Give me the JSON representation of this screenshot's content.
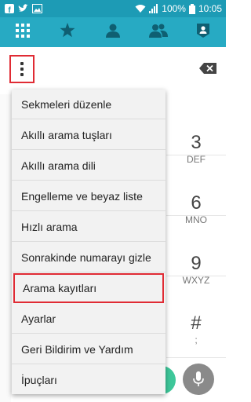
{
  "status_bar": {
    "left_icons": [
      "facebook-icon",
      "twitter-icon",
      "image-icon"
    ],
    "battery": "100%",
    "time": "10:05"
  },
  "tabs": [
    {
      "name": "dialpad-tab",
      "icon": "grid-icon",
      "active": true
    },
    {
      "name": "favorites-tab",
      "icon": "star-icon",
      "active": false
    },
    {
      "name": "contacts-tab",
      "icon": "person-icon",
      "active": false
    },
    {
      "name": "groups-tab",
      "icon": "group-icon",
      "active": false
    },
    {
      "name": "profile-tab",
      "icon": "profile-badge-icon",
      "active": false
    }
  ],
  "keypad": {
    "keys": [
      {
        "num": "3",
        "sub": "DEF"
      },
      {
        "num": "6",
        "sub": "MNO"
      },
      {
        "num": "9",
        "sub": "WXYZ"
      },
      {
        "num": "#",
        "sub": ";"
      }
    ]
  },
  "menu": {
    "items": [
      "Sekmeleri düzenle",
      "Akıllı arama tuşları",
      "Akıllı arama dili",
      "Engelleme ve beyaz liste",
      "Hızlı arama",
      "Sonrakinde numarayı gizle",
      "Arama kayıtları",
      "Ayarlar",
      "Geri Bildirim ve Yardım",
      "İpuçları"
    ],
    "highlighted_index": 6
  },
  "colors": {
    "status_bar": "#1d9bb5",
    "tab_bar": "#27aac3",
    "highlight_border": "#e02b34",
    "call_button": "#3ec79a"
  }
}
